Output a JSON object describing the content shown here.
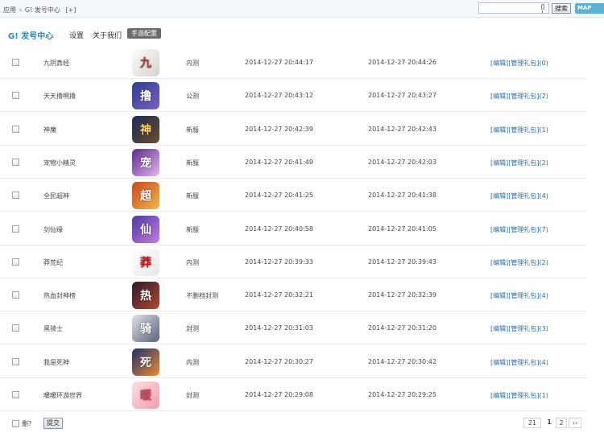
{
  "topbar": {
    "crumbs": [
      "应用",
      "G! 发号中心",
      "[+]"
    ],
    "search_placeholder": "",
    "search_button": "搜索",
    "map_button": "MAP"
  },
  "subnav": {
    "title": "G! 发号中心",
    "links": [
      "设置",
      "关于我们"
    ],
    "active": "手游配置"
  },
  "rows": [
    {
      "name": "九阴真经",
      "icon": "jiuyin-zhenjing-icon",
      "status": "内测",
      "created": "2014-12-27 20:44:17",
      "updated": "2014-12-27 20:44:26",
      "edit": "[编辑]",
      "manage": "[管理礼包]",
      "count": "(0)"
    },
    {
      "name": "天天撸啊撸",
      "icon": "tiantian-luluu-icon",
      "status": "公测",
      "created": "2014-12-27 20:43:12",
      "updated": "2014-12-27 20:43:27",
      "edit": "[编辑]",
      "manage": "[管理礼包]",
      "count": "(2)"
    },
    {
      "name": "神魔",
      "icon": "shenmo-icon",
      "status": "新服",
      "created": "2014-12-27 20:42:39",
      "updated": "2014-12-27 20:42:43",
      "edit": "[编辑]",
      "manage": "[管理礼包]",
      "count": "(1)"
    },
    {
      "name": "宠物小精灵",
      "icon": "pet-sprite-icon",
      "status": "新服",
      "created": "2014-12-27 20:41:49",
      "updated": "2014-12-27 20:42:03",
      "edit": "[编辑]",
      "manage": "[管理礼包]",
      "count": "(2)"
    },
    {
      "name": "全民超神",
      "icon": "quanmin-chaoshen-icon",
      "status": "新服",
      "created": "2014-12-27 20:41:25",
      "updated": "2014-12-27 20:41:38",
      "edit": "[编辑]",
      "manage": "[管理礼包]",
      "count": "(4)"
    },
    {
      "name": "剑仙缘",
      "icon": "jianxianyuan-icon",
      "status": "新服",
      "created": "2014-12-27 20:40:58",
      "updated": "2014-12-27 20:41:05",
      "edit": "[编辑]",
      "manage": "[管理礼包]",
      "count": "(7)"
    },
    {
      "name": "莽荒纪",
      "icon": "manghuangji-icon",
      "status": "内测",
      "created": "2014-12-27 20:39:33",
      "updated": "2014-12-27 20:39:43",
      "edit": "[编辑]",
      "manage": "[管理礼包]",
      "count": "(2)"
    },
    {
      "name": "热血封神榜",
      "icon": "rexue-fengshen-icon",
      "status": "不删档封测",
      "created": "2014-12-27 20:32:21",
      "updated": "2014-12-27 20:32:39",
      "edit": "[编辑]",
      "manage": "[管理礼包]",
      "count": "(4)"
    },
    {
      "name": "黑骑士",
      "icon": "black-knight-icon",
      "status": "封测",
      "created": "2014-12-27 20:31:03",
      "updated": "2014-12-27 20:31:20",
      "edit": "[编辑]",
      "manage": "[管理礼包]",
      "count": "(3)"
    },
    {
      "name": "我是死神",
      "icon": "bleach-icon",
      "status": "内测",
      "created": "2014-12-27 20:30:27",
      "updated": "2014-12-27 20:30:42",
      "edit": "[编辑]",
      "manage": "[管理礼包]",
      "count": "(4)"
    },
    {
      "name": "暖暖环游世界",
      "icon": "nuannuan-icon",
      "status": "封测",
      "created": "2014-12-27 20:29:08",
      "updated": "2014-12-27 20:29:25",
      "edit": "[编辑]",
      "manage": "[管理礼包]",
      "count": "(1)"
    }
  ],
  "footer": {
    "delete_label": "删?",
    "submit_label": "提交",
    "total": "21",
    "pages": [
      "1",
      "2"
    ],
    "current_page": "1",
    "next": "››"
  },
  "colors": {
    "accent": "#1e8bb7",
    "link": "#2c6da8",
    "nav_active_bg": "#6a6a6a",
    "map_button": "#5ab1d0"
  }
}
